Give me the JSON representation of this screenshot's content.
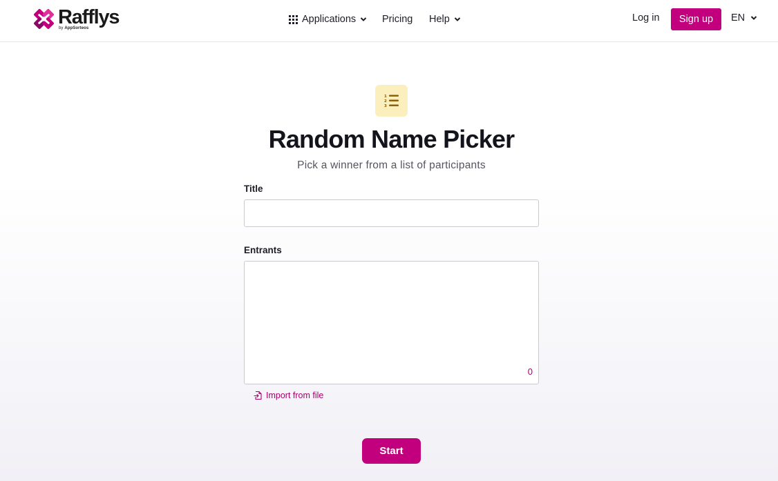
{
  "header": {
    "logo": {
      "name": "Rafflys",
      "byline_prefix": "by",
      "byline_brand": "AppSorteos"
    },
    "nav": {
      "applications": "Applications",
      "pricing": "Pricing",
      "help": "Help"
    },
    "login_label": "Log in",
    "signup_label": "Sign up",
    "language": "EN"
  },
  "main": {
    "icon": "numbered-list-icon",
    "title": "Random Name Picker",
    "subtitle": "Pick a winner from a list of participants",
    "title_field": {
      "label": "Title",
      "value": "",
      "placeholder": ""
    },
    "entrants_field": {
      "label": "Entrants",
      "value": "",
      "count": "0"
    },
    "import_label": "Import from file",
    "start_label": "Start"
  },
  "colors": {
    "brand": "#c2007e",
    "icon_bg": "#fbefbe",
    "icon_fg": "#8a5a00"
  }
}
